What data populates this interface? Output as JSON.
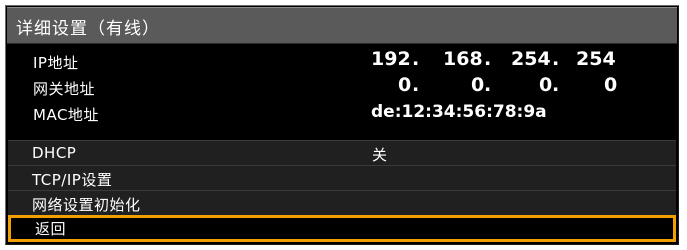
{
  "title": "详细设置（有线）",
  "info": {
    "ip": {
      "label": "IP地址",
      "octets": [
        "192",
        "168",
        "254",
        "254"
      ]
    },
    "gateway": {
      "label": "网关地址",
      "octets": [
        "0",
        "0",
        "0",
        "0"
      ]
    },
    "mac": {
      "label": "MAC地址",
      "value": "de:12:34:56:78:9a"
    }
  },
  "menu": {
    "dhcp": {
      "label": "DHCP",
      "value": "关"
    },
    "tcpip": {
      "label": "TCP/IP设置"
    },
    "reset": {
      "label": "网络设置初始化"
    },
    "back": {
      "label": "返回"
    }
  },
  "colors": {
    "accent": "#f2a000",
    "title_bg": "#5a5a5a",
    "row_bg": "#202020"
  }
}
